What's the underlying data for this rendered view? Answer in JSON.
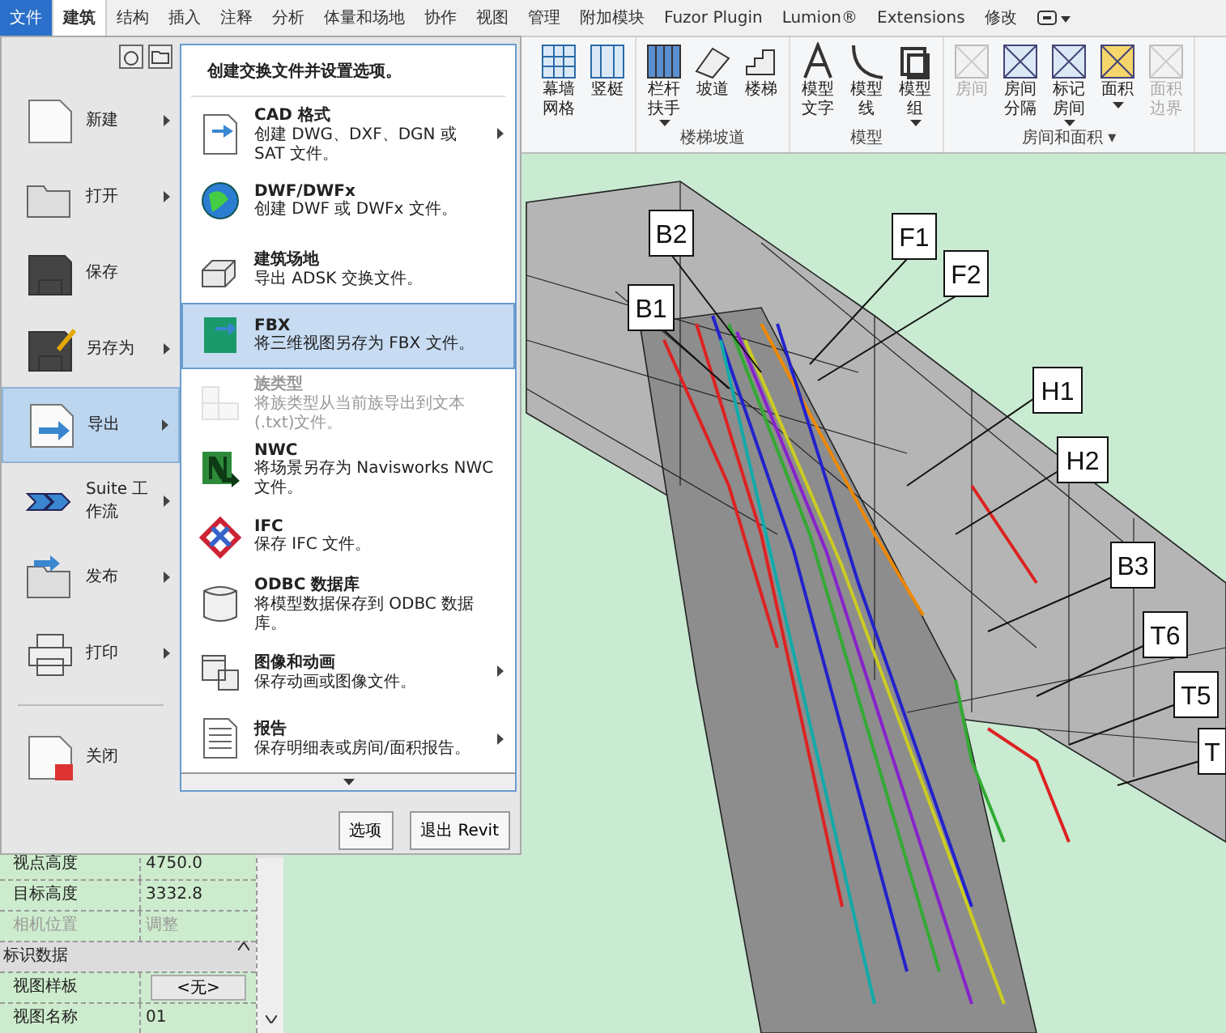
{
  "tabs": [
    {
      "label": "文件",
      "kind": "file",
      "selected": false
    },
    {
      "label": "建筑",
      "kind": "tab",
      "selected": true
    },
    {
      "label": "结构",
      "kind": "tab",
      "selected": false
    },
    {
      "label": "插入",
      "kind": "tab",
      "selected": false
    },
    {
      "label": "注释",
      "kind": "tab",
      "selected": false
    },
    {
      "label": "分析",
      "kind": "tab",
      "selected": false
    },
    {
      "label": "体量和场地",
      "kind": "tab",
      "selected": false
    },
    {
      "label": "协作",
      "kind": "tab",
      "selected": false
    },
    {
      "label": "视图",
      "kind": "tab",
      "selected": false
    },
    {
      "label": "管理",
      "kind": "tab",
      "selected": false
    },
    {
      "label": "附加模块",
      "kind": "tab",
      "selected": false
    },
    {
      "label": "Fuzor Plugin",
      "kind": "tab",
      "selected": false
    },
    {
      "label": "Lumion®",
      "kind": "tab",
      "selected": false
    },
    {
      "label": "Extensions",
      "kind": "tab",
      "selected": false
    },
    {
      "label": "修改",
      "kind": "tab",
      "selected": false
    }
  ],
  "ribbon": {
    "groups": [
      {
        "buttons": [
          {
            "label": "幕墙网格",
            "dropdown": false,
            "disabled": false
          },
          {
            "label": "竖梃",
            "dropdown": false,
            "disabled": false
          }
        ]
      },
      {
        "label": "楼梯坡道",
        "buttons": [
          {
            "label": "栏杆扶手",
            "dropdown": true,
            "disabled": false
          },
          {
            "label": "坡道",
            "dropdown": false,
            "disabled": false
          },
          {
            "label": "楼梯",
            "dropdown": false,
            "disabled": false
          }
        ]
      },
      {
        "label": "模型",
        "buttons": [
          {
            "label": "模型文字",
            "dropdown": false,
            "disabled": false
          },
          {
            "label": "模型线",
            "dropdown": false,
            "disabled": false
          },
          {
            "label": "模型组",
            "dropdown": true,
            "disabled": false
          }
        ]
      },
      {
        "label": "房间和面积 ▾",
        "buttons": [
          {
            "label": "房间",
            "dropdown": false,
            "disabled": true
          },
          {
            "label": "房间分隔",
            "dropdown": false,
            "disabled": false
          },
          {
            "label": "标记房间",
            "dropdown": true,
            "disabled": false
          },
          {
            "label": "面积",
            "dropdown": true,
            "disabled": false
          },
          {
            "label": "面积边界",
            "dropdown": false,
            "disabled": true
          }
        ]
      }
    ]
  },
  "app_menu": {
    "items": [
      {
        "label": "新建",
        "submenu": true,
        "selected": false
      },
      {
        "label": "打开",
        "submenu": true,
        "selected": false
      },
      {
        "label": "保存",
        "submenu": false,
        "selected": false
      },
      {
        "label": "另存为",
        "submenu": true,
        "selected": false
      },
      {
        "label": "导出",
        "submenu": true,
        "selected": true
      },
      {
        "label": "Suite 工作流",
        "submenu": true,
        "selected": false
      },
      {
        "label": "发布",
        "submenu": true,
        "selected": false
      },
      {
        "label": "打印",
        "submenu": true,
        "selected": false
      },
      {
        "label": "关闭",
        "submenu": false,
        "selected": false
      }
    ],
    "header": "创建交换文件并设置选项。",
    "export_items": [
      {
        "title": "CAD 格式",
        "description": "创建 DWG、DXF、DGN 或 SAT 文件。",
        "submenu": true,
        "selected": false,
        "disabled": false
      },
      {
        "title": "DWF/DWFx",
        "description": "创建 DWF 或 DWFx 文件。",
        "submenu": false,
        "selected": false,
        "disabled": false
      },
      {
        "title": "建筑场地",
        "description": "导出 ADSK 交换文件。",
        "submenu": false,
        "selected": false,
        "disabled": false
      },
      {
        "title": "FBX",
        "description": "将三维视图另存为 FBX 文件。",
        "submenu": false,
        "selected": true,
        "disabled": false
      },
      {
        "title": "族类型",
        "description": "将族类型从当前族导出到文本(.txt)文件。",
        "submenu": false,
        "selected": false,
        "disabled": true
      },
      {
        "title": "NWC",
        "description": "将场景另存为 Navisworks NWC 文件。",
        "submenu": false,
        "selected": false,
        "disabled": false
      },
      {
        "title": "IFC",
        "description": "保存 IFC 文件。",
        "submenu": false,
        "selected": false,
        "disabled": false
      },
      {
        "title": "ODBC 数据库",
        "description": "将模型数据保存到 ODBC 数据库。",
        "submenu": false,
        "selected": false,
        "disabled": false
      },
      {
        "title": "图像和动画",
        "description": "保存动画或图像文件。",
        "submenu": true,
        "selected": false,
        "disabled": false
      },
      {
        "title": "报告",
        "description": "保存明细表或房间/面积报告。",
        "submenu": true,
        "selected": false,
        "disabled": false
      }
    ],
    "buttons": [
      "选项",
      "退出 Revit"
    ]
  },
  "properties": {
    "rows": [
      {
        "kind": "field",
        "name": "视点高度",
        "value": "4750.0",
        "disabled": false
      },
      {
        "kind": "field",
        "name": "目标高度",
        "value": "3332.8",
        "disabled": false
      },
      {
        "kind": "field",
        "name": "相机位置",
        "value": "调整",
        "disabled": true
      },
      {
        "kind": "section",
        "name": "标识数据"
      },
      {
        "kind": "button",
        "name": "视图样板",
        "value": "<无>",
        "disabled": false
      },
      {
        "kind": "field",
        "name": "视图名称",
        "value": "01",
        "disabled": false
      }
    ]
  },
  "view": {
    "callouts": [
      {
        "label": "B2"
      },
      {
        "label": "F1"
      },
      {
        "label": "F2"
      },
      {
        "label": "B1"
      },
      {
        "label": "H1"
      },
      {
        "label": "H2"
      },
      {
        "label": "B3"
      },
      {
        "label": "T6"
      },
      {
        "label": "T5"
      },
      {
        "label": "T"
      }
    ]
  }
}
